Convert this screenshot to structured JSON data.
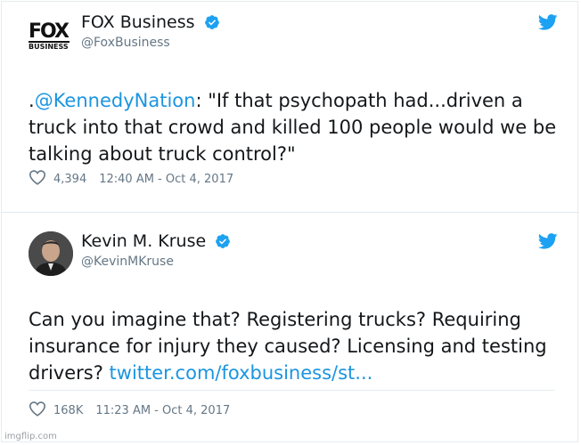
{
  "tweets": [
    {
      "name": "FOX Business",
      "handle": "@FoxBusiness",
      "logo": {
        "fox": "FOX",
        "biz": "BUSINESS"
      },
      "text_prefix": ".",
      "mention": "@KennedyNation",
      "text": ": \"If that psychopath had...driven a truck into that crowd and killed 100 people would we be talking about truck control?\"",
      "likes": "4,394",
      "timestamp": "12:40 AM - Oct 4, 2017"
    },
    {
      "name": "Kevin M. Kruse",
      "handle": "@KevinMKruse",
      "text": "Can you imagine that? Registering trucks? Requiring insurance for injury they caused? Licensing and testing drivers? ",
      "link": "twitter.com/foxbusiness/st...",
      "likes": "168K",
      "timestamp": "11:23 AM - Oct 4, 2017"
    }
  ],
  "watermark": "imgflip.com",
  "colors": {
    "verified": "#1da1f2",
    "link": "#1b95e0",
    "twitter_bird": "#1da1f2",
    "secondary_text": "#657786"
  },
  "icons": [
    "fox-business-logo",
    "verified-badge-icon",
    "twitter-bird-icon",
    "heart-icon",
    "avatar"
  ]
}
